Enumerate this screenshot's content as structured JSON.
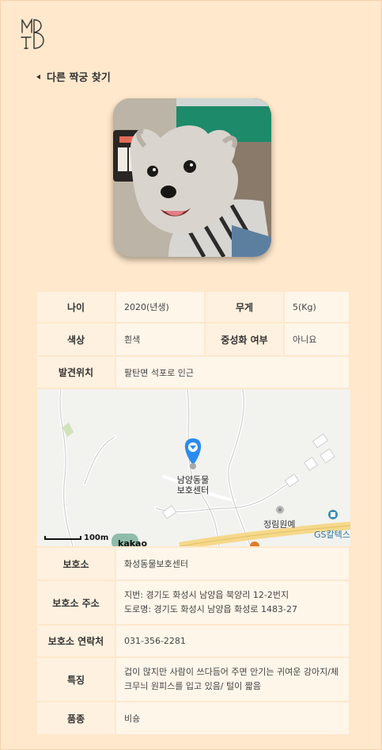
{
  "logo": {
    "text": "MBTI"
  },
  "nav": {
    "back_label": "다른 짝궁 찾기"
  },
  "pet": {
    "photo_alt": "강아지 사진",
    "age_label": "나이",
    "age": "2020(년생)",
    "weight_label": "무게",
    "weight": "5(Kg)",
    "color_label": "색상",
    "color": "흰색",
    "neuter_label": "중성화 여부",
    "neuter": "아니요",
    "found_label": "발견위치",
    "found_place": "팔탄면 석포로 인근",
    "shelter_label": "보호소",
    "shelter": "화성동물보호센터",
    "address_label": "보호소 주소",
    "address_lot": "지번: 경기도 화성시 남양읍 북양리 12-2번지",
    "address_road": "도로명: 경기도 화성시 남양읍 화성로 1483-27",
    "contact_label": "보호소 연락처",
    "contact": "031-356-2281",
    "feature_label": "특징",
    "feature": "겁이 많지만 사람이 쓰다듬어 주면 안기는 귀여운 강아지/체크무늬 원피스를 입고 있음/ 털이 짧음",
    "breed_label": "품종",
    "breed": "비숑"
  },
  "map": {
    "marker_line1": "남양동물",
    "marker_line2": "보호센터",
    "poi1": "정림원예",
    "poi2": "GS칼텍스",
    "scale": "100m",
    "brand": "kakao"
  },
  "colors": {
    "background": "#ffe8cc",
    "table_bg": "#fff6ea",
    "marker": "#2a8cf0"
  }
}
